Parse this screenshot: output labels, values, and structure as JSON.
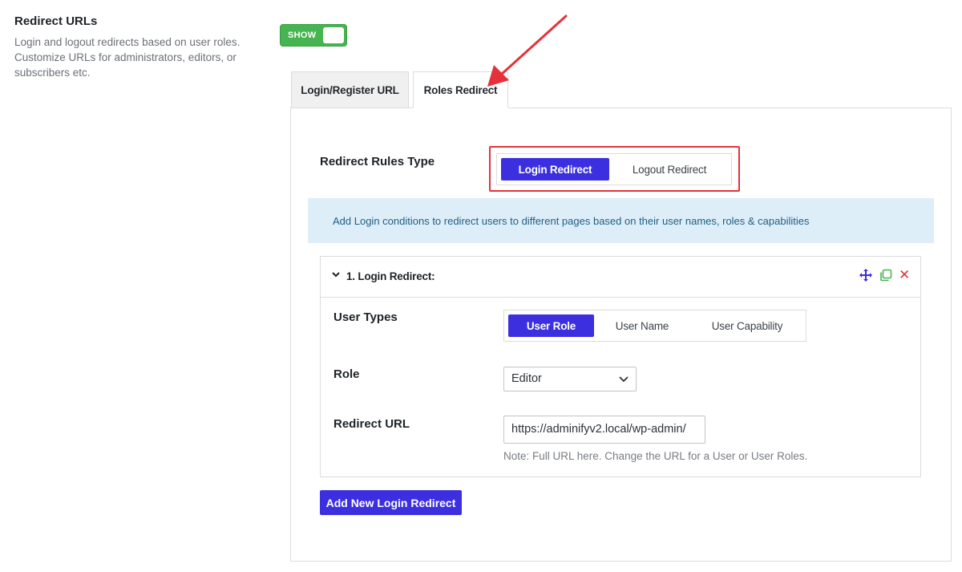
{
  "field": {
    "title": "Redirect URLs",
    "description": "Login and logout redirects based on user roles. Customize URLs for administrators, editors, or subscribers etc."
  },
  "toggle": {
    "label": "SHOW",
    "state": "on"
  },
  "tabs": [
    {
      "label": "Login/Register URL",
      "active": false
    },
    {
      "label": "Roles Redirect",
      "active": true
    }
  ],
  "rules_type": {
    "label": "Redirect Rules Type",
    "options": [
      "Login Redirect",
      "Logout Redirect"
    ],
    "selected": "Login Redirect"
  },
  "notice": "Add Login conditions to redirect users to different pages based on their user names, roles & capabilities",
  "rule": {
    "title": "1. Login Redirect:",
    "user_types_label": "User Types",
    "user_types": [
      "User Role",
      "User Name",
      "User Capability"
    ],
    "user_type_selected": "User Role",
    "role_label": "Role",
    "role_value": "Editor",
    "redirect_url_label": "Redirect URL",
    "redirect_url_value": "https://adminifyv2.local/wp-admin/",
    "note": "Note: Full URL here. Change the URL for a User or User Roles."
  },
  "add_button": "Add New Login Redirect",
  "colors": {
    "accent": "#3b2fe0",
    "toggle_green": "#46b450",
    "highlight_red": "#e5313b",
    "notice_bg": "#ddeef8"
  },
  "icons": [
    "chevron-down-icon",
    "move-icon",
    "copy-icon",
    "close-icon",
    "select-chevron-icon"
  ]
}
